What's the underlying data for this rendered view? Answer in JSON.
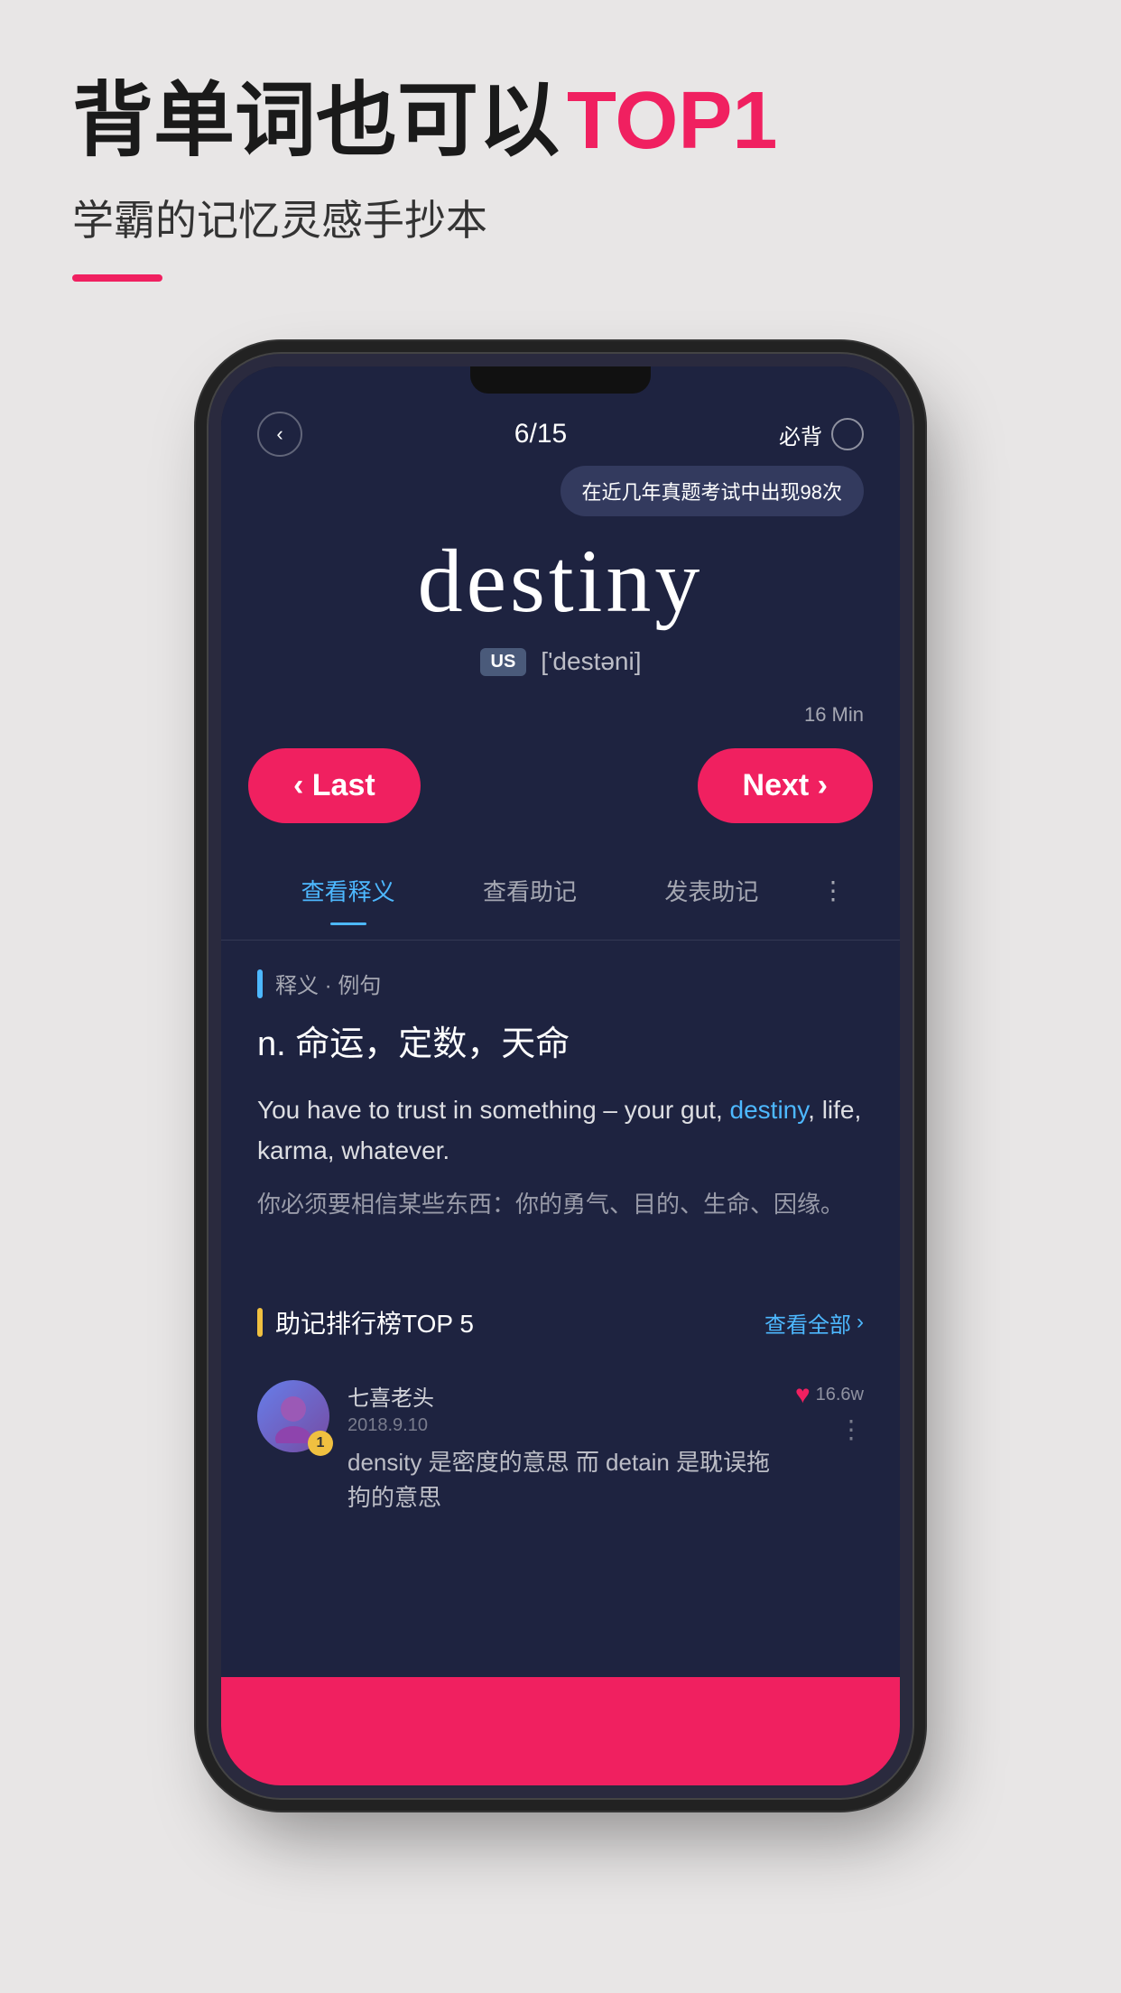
{
  "page": {
    "background_color": "#e8e6e6"
  },
  "top": {
    "title_part1": "背单词也可以",
    "title_highlight": "TOP1",
    "subtitle": "学霸的记忆灵感手抄本"
  },
  "phone": {
    "nav": {
      "back_icon": "‹",
      "progress": "6/15",
      "must_memorize_label": "必背",
      "circle_icon": "○"
    },
    "tooltip": "在近几年真题考试中出现98次",
    "word": {
      "text": "destiny",
      "pronunciation_badge": "US",
      "phonetic": "['destəni]"
    },
    "nav_buttons": {
      "min_label": "16 Min",
      "last_label": "‹ Last",
      "next_label": "Next ›"
    },
    "tabs": [
      {
        "id": "definition",
        "label": "查看释义",
        "active": true
      },
      {
        "id": "mnemonic",
        "label": "查看助记",
        "active": false
      },
      {
        "id": "post_mnemonic",
        "label": "发表助记",
        "active": false
      }
    ],
    "content": {
      "section_label": "释义 · 例句",
      "definition": "n.  命运，定数，天命",
      "example_en_prefix": "You have to trust in something –\nyour gut, ",
      "example_en_word": "destiny",
      "example_en_suffix": ", life, karma, whatever.",
      "example_cn": "你必须要相信某些东西：你的勇气、目的、生命、因缘。"
    },
    "mnemonic": {
      "section_label": "助记排行榜TOP 5",
      "view_all": "查看全部",
      "items": [
        {
          "rank": "1",
          "author": "七喜老头",
          "date": "2018.9.10",
          "like_count": "16.6w",
          "text": "density 是密度的意思 而 detain 是耽误拖拘的意思"
        }
      ]
    }
  }
}
